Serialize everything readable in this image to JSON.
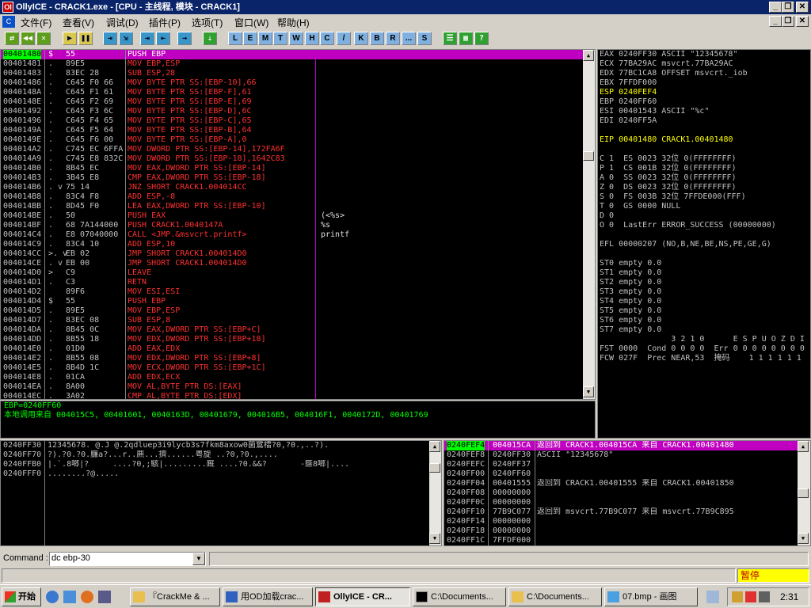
{
  "window": {
    "title": "OllyICE - CRACK1.exe - [CPU - 主线程, 模块 - CRACK1]",
    "min": "_",
    "restore": "❐",
    "close": "✕",
    "icon": "OI"
  },
  "menu": {
    "icon": "C",
    "items": [
      "文件(F)",
      "查看(V)",
      "调试(D)",
      "插件(P)",
      "选项(T)",
      "窗口(W)",
      "帮助(H)"
    ],
    "min": "_",
    "restore": "❐",
    "close": "✕"
  },
  "toolbar": {
    "buttons": [
      "⇄",
      "◀◀",
      "✕",
      "▶",
      "❚❚",
      "⇥",
      "⇲",
      "⇥",
      "⇤",
      "→",
      "⇣"
    ],
    "letters": [
      "L",
      "E",
      "M",
      "T",
      "W",
      "H",
      "C",
      "/",
      "K",
      "B",
      "R",
      "...",
      "S"
    ],
    "view_buttons": [
      "☰",
      "▦",
      "?"
    ]
  },
  "disasm": {
    "rows": [
      {
        "a": "00401480",
        "m": "$",
        "h": "55",
        "i": "PUSH EBP",
        "sel": true
      },
      {
        "a": "00401481",
        "m": ".",
        "h": "89E5",
        "i": "MOV EBP,ESP"
      },
      {
        "a": "00401483",
        "m": ".",
        "h": "83EC 28",
        "i": "SUB ESP,28"
      },
      {
        "a": "00401486",
        "m": ".",
        "h": "C645 F0 66",
        "i": "MOV BYTE PTR SS:[EBP-10],66"
      },
      {
        "a": "0040148A",
        "m": ".",
        "h": "C645 F1 61",
        "i": "MOV BYTE PTR SS:[EBP-F],61"
      },
      {
        "a": "0040148E",
        "m": ".",
        "h": "C645 F2 69",
        "i": "MOV BYTE PTR SS:[EBP-E],69"
      },
      {
        "a": "00401492",
        "m": ".",
        "h": "C645 F3 6C",
        "i": "MOV BYTE PTR SS:[EBP-D],6C"
      },
      {
        "a": "00401496",
        "m": ".",
        "h": "C645 F4 65",
        "i": "MOV BYTE PTR SS:[EBP-C],65"
      },
      {
        "a": "0040149A",
        "m": ".",
        "h": "C645 F5 64",
        "i": "MOV BYTE PTR SS:[EBP-B],64"
      },
      {
        "a": "0040149E",
        "m": ".",
        "h": "C645 F6 00",
        "i": "MOV BYTE PTR SS:[EBP-A],0"
      },
      {
        "a": "004014A2",
        "m": ".",
        "h": "C745 EC 6FFA",
        "i": "MOV DWORD PTR SS:[EBP-14],172FA6F"
      },
      {
        "a": "004014A9",
        "m": ".",
        "h": "C745 E8 832C",
        "i": "MOV DWORD PTR SS:[EBP-18],1642C83"
      },
      {
        "a": "004014B0",
        "m": ".",
        "h": "8B45 EC",
        "i": "MOV EAX,DWORD PTR SS:[EBP-14]"
      },
      {
        "a": "004014B3",
        "m": ".",
        "h": "3B45 E8",
        "i": "CMP EAX,DWORD PTR SS:[EBP-18]"
      },
      {
        "a": "004014B6",
        "m": ". v",
        "h": "75 14",
        "i": "JNZ SHORT CRACK1.004014CC"
      },
      {
        "a": "004014B8",
        "m": ".",
        "h": "83C4 F8",
        "i": "ADD ESP,-8"
      },
      {
        "a": "004014BB",
        "m": ".",
        "h": "8D45 F0",
        "i": "LEA EAX,DWORD PTR SS:[EBP-10]"
      },
      {
        "a": "004014BE",
        "m": ".",
        "h": "50",
        "i": "PUSH EAX"
      },
      {
        "a": "004014BF",
        "m": ".",
        "h": "68 7A144000",
        "i": "PUSH CRACK1.0040147A"
      },
      {
        "a": "004014C4",
        "m": ".",
        "h": "E8 07040000",
        "i": "CALL <JMP.&msvcrt.printf>"
      },
      {
        "a": "004014C9",
        "m": ".",
        "h": "83C4 10",
        "i": "ADD ESP,10"
      },
      {
        "a": "004014CC",
        "m": ">. v",
        "h": "EB 02",
        "i": "JMP SHORT CRACK1.004014D0"
      },
      {
        "a": "004014CE",
        "m": ". v",
        "h": "EB 00",
        "i": "JMP SHORT CRACK1.004014D0"
      },
      {
        "a": "004014D0",
        "m": ">",
        "h": "C9",
        "i": "LEAVE"
      },
      {
        "a": "004014D1",
        "m": ".",
        "h": "C3",
        "i": "RETN"
      },
      {
        "a": "004014D2",
        "m": "",
        "h": "89F6",
        "i": "MOV ESI,ESI"
      },
      {
        "a": "004014D4",
        "m": "$",
        "h": "55",
        "i": "PUSH EBP"
      },
      {
        "a": "004014D5",
        "m": ".",
        "h": "89E5",
        "i": "MOV EBP,ESP"
      },
      {
        "a": "004014D7",
        "m": ".",
        "h": "83EC 08",
        "i": "SUB ESP,8"
      },
      {
        "a": "004014DA",
        "m": ".",
        "h": "8B45 0C",
        "i": "MOV EAX,DWORD PTR SS:[EBP+C]"
      },
      {
        "a": "004014DD",
        "m": ".",
        "h": "8B55 18",
        "i": "MOV EDX,DWORD PTR SS:[EBP+18]"
      },
      {
        "a": "004014E0",
        "m": ".",
        "h": "01D0",
        "i": "ADD EAX,EDX"
      },
      {
        "a": "004014E2",
        "m": ".",
        "h": "8B55 08",
        "i": "MOV EDX,DWORD PTR SS:[EBP+8]"
      },
      {
        "a": "004014E5",
        "m": ".",
        "h": "8B4D 1C",
        "i": "MOV ECX,DWORD PTR SS:[EBP+1C]"
      },
      {
        "a": "004014E8",
        "m": ".",
        "h": "01CA",
        "i": "ADD EDX,ECX"
      },
      {
        "a": "004014EA",
        "m": ".",
        "h": "8A00",
        "i": "MOV AL,BYTE PTR DS:[EAX]"
      },
      {
        "a": "004014EC",
        "m": ".",
        "h": "3A02",
        "i": "CMP AL,BYTE PTR DS:[EDX]"
      }
    ],
    "comments": [
      {
        "row": 17,
        "t": "(<%s>"
      },
      {
        "row": 18,
        "t": "%s"
      },
      {
        "row": 19,
        "t": "printf"
      }
    ],
    "scroll_up": "▲",
    "scroll_down": "▼"
  },
  "info": {
    "line1": "EBP=0240FF60",
    "line2": "本地调用来自 004015C5, 00401601, 0040163D, 00401679, 004016B5, 004016F1, 0040172D, 00401769"
  },
  "registers": {
    "lines": [
      {
        "t": "EAX 0240FF30 ASCII \"12345678\"",
        "c": "#c0c0c0"
      },
      {
        "t": "ECX 77BA29AC msvcrt.77BA29AC",
        "c": "#c0c0c0"
      },
      {
        "t": "EDX 77BC1CA8 OFFSET msvcrt._iob",
        "c": "#c0c0c0"
      },
      {
        "t": "EBX 7FFDF000",
        "c": "#c0c0c0"
      },
      {
        "t": "ESP 0240FEF4",
        "c": "#ffff00"
      },
      {
        "t": "EBP 0240FF60",
        "c": "#c0c0c0"
      },
      {
        "t": "ESI 00401543 ASCII \"%c\"",
        "c": "#c0c0c0"
      },
      {
        "t": "EDI 0240FF5A",
        "c": "#c0c0c0"
      },
      {
        "t": "",
        "c": "#c0c0c0"
      },
      {
        "t": "EIP 00401480 CRACK1.00401480",
        "c": "#ffff00"
      },
      {
        "t": "",
        "c": "#c0c0c0"
      },
      {
        "t": "C 1  ES 0023 32位 0(FFFFFFFF)",
        "c": "#c0c0c0"
      },
      {
        "t": "P 1  CS 001B 32位 0(FFFFFFFF)",
        "c": "#c0c0c0"
      },
      {
        "t": "A 0  SS 0023 32位 0(FFFFFFFF)",
        "c": "#c0c0c0"
      },
      {
        "t": "Z 0  DS 0023 32位 0(FFFFFFFF)",
        "c": "#c0c0c0"
      },
      {
        "t": "S 0  FS 003B 32位 7FFDE000(FFF)",
        "c": "#c0c0c0"
      },
      {
        "t": "T 0  GS 0000 NULL",
        "c": "#c0c0c0"
      },
      {
        "t": "D 0",
        "c": "#c0c0c0"
      },
      {
        "t": "O 0  LastErr ERROR_SUCCESS (00000000)",
        "c": "#c0c0c0"
      },
      {
        "t": "",
        "c": "#c0c0c0"
      },
      {
        "t": "EFL 00000207 (NO,B,NE,BE,NS,PE,GE,G)",
        "c": "#c0c0c0"
      },
      {
        "t": "",
        "c": "#c0c0c0"
      },
      {
        "t": "ST0 empty 0.0",
        "c": "#c0c0c0"
      },
      {
        "t": "ST1 empty 0.0",
        "c": "#c0c0c0"
      },
      {
        "t": "ST2 empty 0.0",
        "c": "#c0c0c0"
      },
      {
        "t": "ST3 empty 0.0",
        "c": "#c0c0c0"
      },
      {
        "t": "ST4 empty 0.0",
        "c": "#c0c0c0"
      },
      {
        "t": "ST5 empty 0.0",
        "c": "#c0c0c0"
      },
      {
        "t": "ST6 empty 0.0",
        "c": "#c0c0c0"
      },
      {
        "t": "ST7 empty 0.0",
        "c": "#c0c0c0"
      },
      {
        "t": "               3 2 1 0      E S P U O Z D I",
        "c": "#c0c0c0"
      },
      {
        "t": "FST 0000  Cond 0 0 0 0  Err 0 0 0 0 0 0 0 0",
        "c": "#c0c0c0"
      },
      {
        "t": "FCW 027F  Prec NEAR,53  掩码    1 1 1 1 1 1",
        "c": "#c0c0c0"
      }
    ]
  },
  "dump": {
    "rows": [
      {
        "a": "0240FF30",
        "d": "12345678. @.J @.2qdluep3i9lycb3s7fkm8axow0菌鷺檑?0,?0.,..?)."
      },
      {
        "a": "0240FF70",
        "d": "?).?0.?0.臁a?...r..麃...擠......粤旋 ..?0,?0.,...."
      },
      {
        "a": "0240FFB0",
        "d": "|.`.8啷|?     ....?0,;駭|.........廐 ....?0.&&?       -篨8啷|...."
      },
      {
        "a": "0240FFF0",
        "d": "........?@....."
      }
    ],
    "scroll_up": "▲",
    "scroll_down": "▼"
  },
  "stack": {
    "rows": [
      {
        "a": "0240FEF4",
        "v": "004015CA",
        "c": "返回到 CRACK1.004015CA 来自 CRACK1.00401480",
        "sel": true
      },
      {
        "a": "0240FEF8",
        "v": "0240FF30",
        "c": "ASCII \"12345678\""
      },
      {
        "a": "0240FEFC",
        "v": "0240FF37",
        "c": ""
      },
      {
        "a": "0240FF00",
        "v": "0240FF60",
        "c": ""
      },
      {
        "a": "0240FF04",
        "v": "00401555",
        "c": "返回到 CRACK1.00401555 来自 CRACK1.00401850"
      },
      {
        "a": "0240FF08",
        "v": "00000000",
        "c": ""
      },
      {
        "a": "0240FF0C",
        "v": "00000000",
        "c": ""
      },
      {
        "a": "0240FF10",
        "v": "77B9C077",
        "c": "返回到 msvcrt.77B9C077 来自 msvcrt.77B9C895"
      },
      {
        "a": "0240FF14",
        "v": "00000000",
        "c": ""
      },
      {
        "a": "0240FF18",
        "v": "00000000",
        "c": ""
      },
      {
        "a": "0240FF1C",
        "v": "7FFDF000",
        "c": ""
      }
    ],
    "scroll_up": "▲",
    "scroll_down": "▼"
  },
  "command": {
    "label": "Command :",
    "value": "dc ebp-30",
    "arrow": "▼"
  },
  "status": {
    "state": "暂停"
  },
  "taskbar": {
    "start": "开始",
    "tasks": [
      "『CrackMe & ...",
      "用OD加载crac...",
      "OllyICE - CR...",
      "C:\\Documents...",
      "C:\\Documents...",
      "07.bmp - 画图"
    ],
    "clock": "2:31"
  },
  "colors": {
    "address": "#c0c0c0",
    "hex": "#c0c0c0",
    "mnemonic": "#ff3030",
    "text": "#c0c0c0",
    "highlight": "#c000c0",
    "stackhl": "#00ff00",
    "comment": "#e0e0e0",
    "green": "#00ff00",
    "yellow": "#ffff00"
  }
}
